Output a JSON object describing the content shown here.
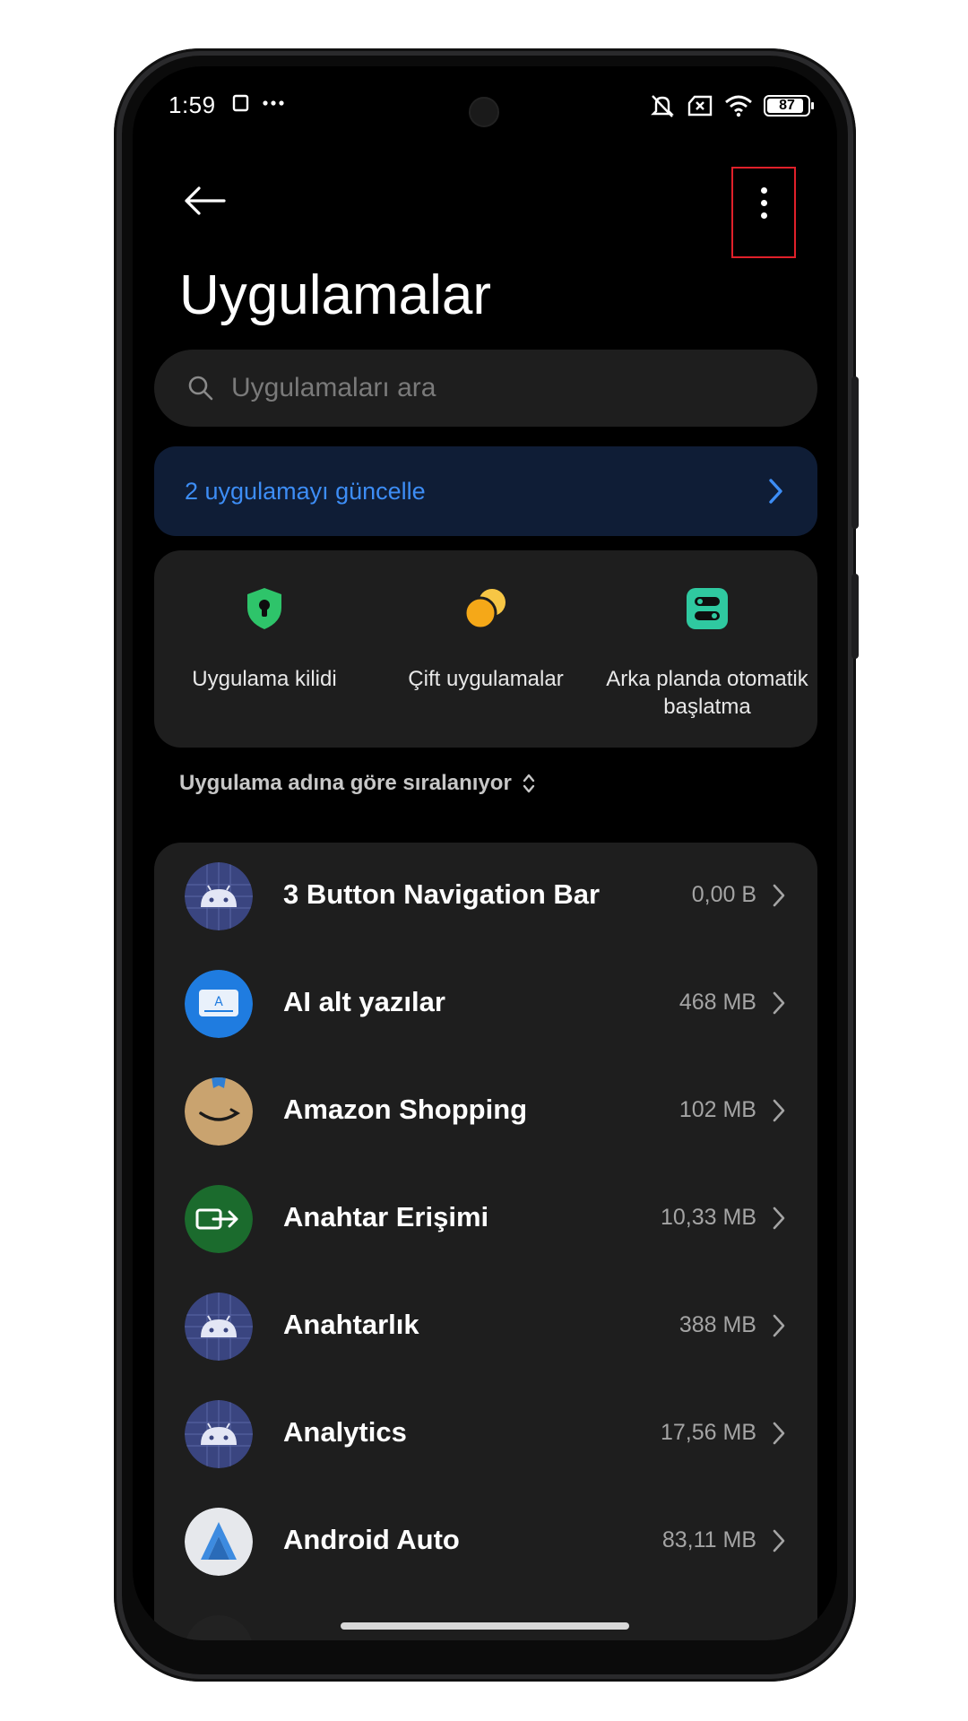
{
  "status_bar": {
    "time": "1:59",
    "battery": "87"
  },
  "header": {
    "title": "Uygulamalar"
  },
  "search": {
    "placeholder": "Uygulamaları ara"
  },
  "update_banner": {
    "label": "2 uygulamayı güncelle",
    "accent": "#3d8df5"
  },
  "quick_actions": [
    {
      "label": "Uygulama kilidi",
      "icon": "shield-lock-icon",
      "color": "#2ec46a"
    },
    {
      "label": "Çift uygulamalar",
      "icon": "dual-apps-icon",
      "color": "#f5b51c"
    },
    {
      "label": "Arka planda otomatik başlatma",
      "icon": "autostart-toggle-icon",
      "color": "#2fc9a0"
    }
  ],
  "sort": {
    "label": "Uygulama adına göre sıralanıyor"
  },
  "apps": [
    {
      "name": "3 Button Navigation Bar",
      "size": "0,00 B",
      "icon": "android-icon"
    },
    {
      "name": "AI alt yazılar",
      "size": "468 MB",
      "icon": "ai-subtitles-icon"
    },
    {
      "name": "Amazon Shopping",
      "size": "102 MB",
      "icon": "amazon-icon"
    },
    {
      "name": "Anahtar Erişimi",
      "size": "10,33 MB",
      "icon": "key-access-icon"
    },
    {
      "name": "Anahtarlık",
      "size": "388 MB",
      "icon": "android-icon"
    },
    {
      "name": "Analytics",
      "size": "17,56 MB",
      "icon": "android-icon"
    },
    {
      "name": "Android Auto",
      "size": "83,11 MB",
      "icon": "android-auto-icon"
    }
  ]
}
